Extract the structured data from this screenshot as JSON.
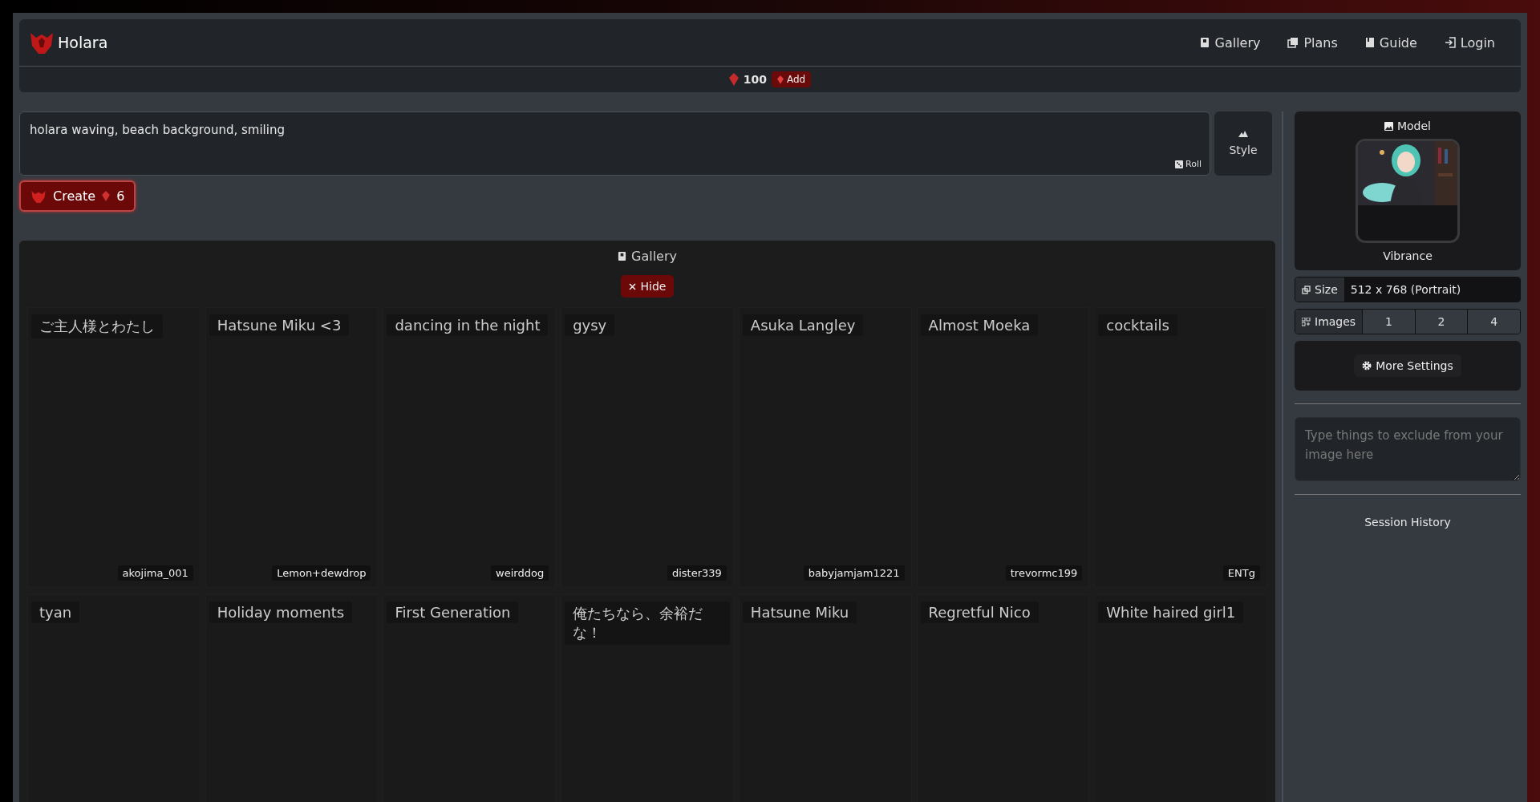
{
  "navbar": {
    "brand": "Holara",
    "links": [
      {
        "label": "Gallery",
        "kind": "book"
      },
      {
        "label": "Plans",
        "kind": "pages"
      },
      {
        "label": "Guide",
        "kind": "doc"
      },
      {
        "label": "Login",
        "kind": "login"
      }
    ]
  },
  "credits": {
    "amount": "100",
    "add_label": "Add"
  },
  "prompt": {
    "value": "holara waving, beach background, smiling",
    "roll_label": "Roll",
    "style_label": "Style"
  },
  "create_button": {
    "label": "Create",
    "cost": "6"
  },
  "gallery": {
    "title": "Gallery",
    "hide_label": "Hide",
    "items": [
      {
        "title": "ご主人様とわたし",
        "author": "akojima_001"
      },
      {
        "title": "Hatsune Miku <3",
        "author": "Lemon+dewdrop"
      },
      {
        "title": "dancing in the night",
        "author": "weirddog"
      },
      {
        "title": "gysy",
        "author": "dister339"
      },
      {
        "title": "Asuka Langley",
        "author": "babyjamjam1221"
      },
      {
        "title": "Almost Moeka",
        "author": "trevormc199"
      },
      {
        "title": "cocktails",
        "author": "ENTg"
      },
      {
        "title": "tyan"
      },
      {
        "title": "Holiday moments"
      },
      {
        "title": "First Generation"
      },
      {
        "title": "俺たちなら、余裕だな！"
      },
      {
        "title": "Hatsune Miku"
      },
      {
        "title": "Regretful Nico"
      },
      {
        "title": "White haired girl1"
      }
    ]
  },
  "sidebar": {
    "model": {
      "label": "Model",
      "name": "Vibrance"
    },
    "size": {
      "label": "Size",
      "value": "512 x 768 (Portrait)"
    },
    "images": {
      "label": "Images",
      "options": [
        "1",
        "2",
        "4"
      ]
    },
    "more_settings": "More Settings",
    "negative_prompt": {
      "placeholder": "Type things to exclude from your image here"
    },
    "session_history": "Session History"
  }
}
